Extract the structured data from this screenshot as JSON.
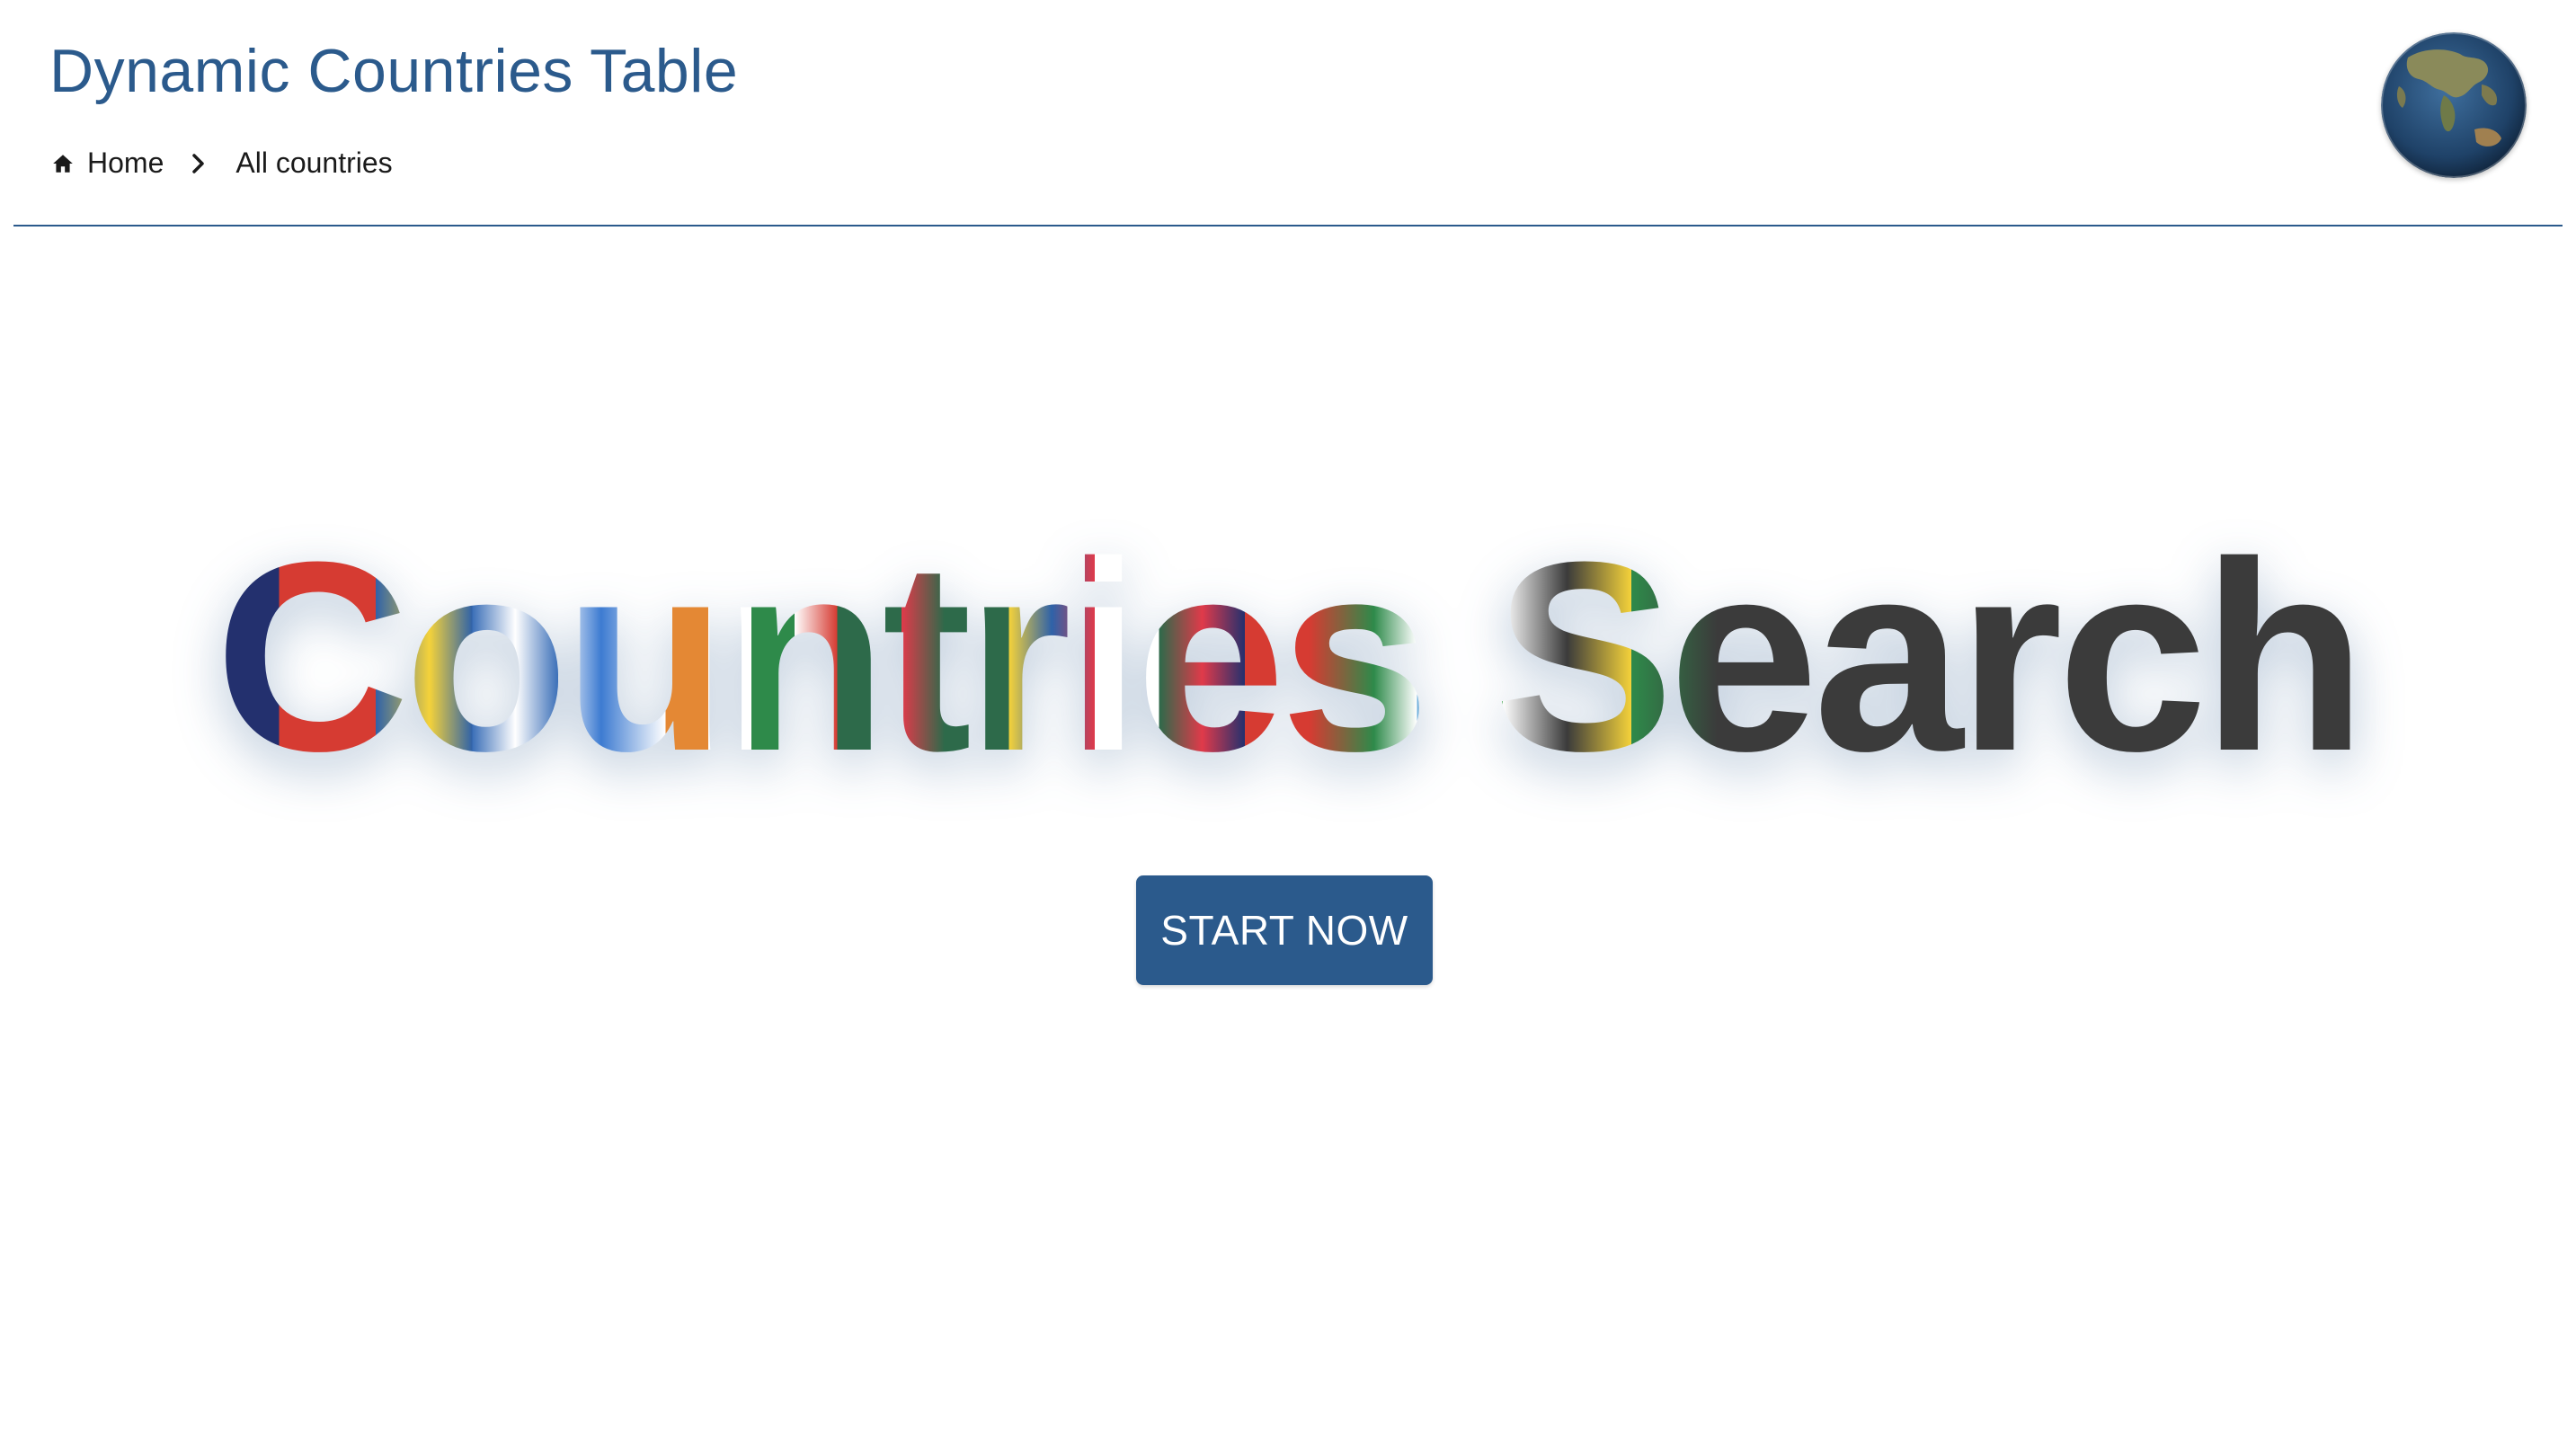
{
  "header": {
    "title": "Dynamic Countries Table",
    "breadcrumb": [
      {
        "label": "Home",
        "icon": "home-icon"
      },
      {
        "label": "All countries"
      }
    ],
    "avatar_icon": "globe-icon"
  },
  "hero": {
    "title": "Countries Search",
    "cta_label": "START NOW"
  },
  "colors": {
    "primary": "#2b5a8c",
    "divider": "#2b5a8c",
    "text": "#1a1a1a",
    "background": "#ffffff"
  }
}
